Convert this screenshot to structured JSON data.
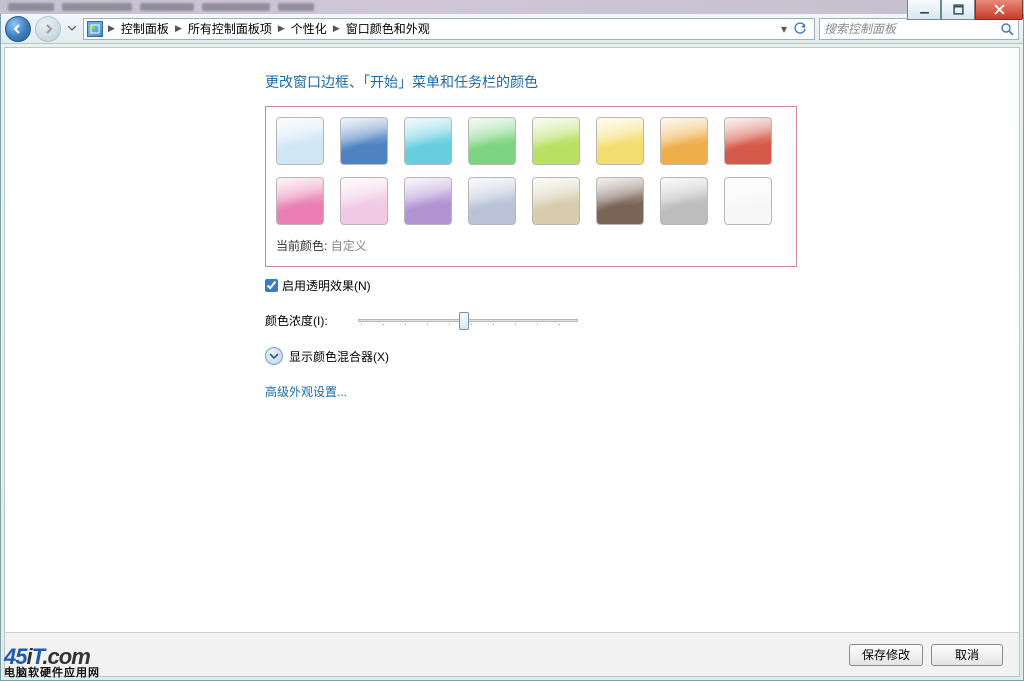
{
  "breadcrumbs": [
    "控制面板",
    "所有控制面板项",
    "个性化",
    "窗口颜色和外观"
  ],
  "search_placeholder": "搜索控制面板",
  "heading": "更改窗口边框、「开始」菜单和任务栏的颜色",
  "current_color_label": "当前颜色:",
  "current_color_value": "自定义",
  "enable_transparency_label": "启用透明效果(N)",
  "enable_transparency_checked": true,
  "intensity_label": "颜色浓度(I):",
  "show_mixer_label": "显示颜色混合器(X)",
  "advanced_link": "高级外观设置...",
  "save_label": "保存修改",
  "cancel_label": "取消",
  "watermark_top": "45iT.com",
  "watermark_bottom": "电脑软硬件应用网",
  "swatches_row1": [
    "#cfe6f5",
    "#4f82c2",
    "#66cedf",
    "#7dd480",
    "#b9e063",
    "#f2dd6e",
    "#efae4a",
    "#d65a4a"
  ],
  "swatches_row2": [
    "#e97fb3",
    "#f2c9e5",
    "#b193d3",
    "#b9c2d6",
    "#d7ccab",
    "#7a6456",
    "#bdbdbd",
    "#f7f7f7"
  ]
}
